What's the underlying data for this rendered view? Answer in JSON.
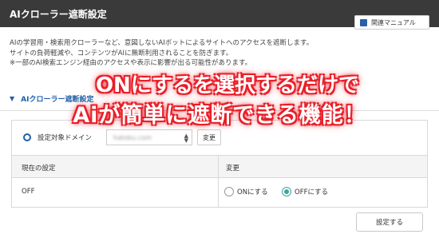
{
  "header": {
    "title": "AIクローラー遮断設定",
    "manual_button": "関連マニュアル"
  },
  "description": {
    "lines": [
      "AIの学習用・検索用クローラーなど、意図しないAIボットによるサイトへのアクセスを遮断します。",
      "サイトの負荷軽減や、コンテンツがAIに無断利用されることを防ぎます。",
      "※一部のAI検索エンジン経由のアクセスや表示に影響が出る可能性があります。"
    ]
  },
  "section": {
    "label": "AIクローラー遮断設定"
  },
  "domain": {
    "label": "設定対象ドメイン",
    "selected": "hatobu.com",
    "change_button": "変更"
  },
  "table": {
    "headers": [
      "現在の設定",
      "変更"
    ],
    "current_value": "OFF",
    "options": [
      {
        "label": "ONにする",
        "checked": false
      },
      {
        "label": "OFFにする",
        "checked": true
      }
    ]
  },
  "submit_button": "設定する",
  "overlay": {
    "line1": "ONにするを選択するだけで",
    "line2": "Aiが簡単に遮断できる機能！",
    "color": "#e8202a"
  }
}
